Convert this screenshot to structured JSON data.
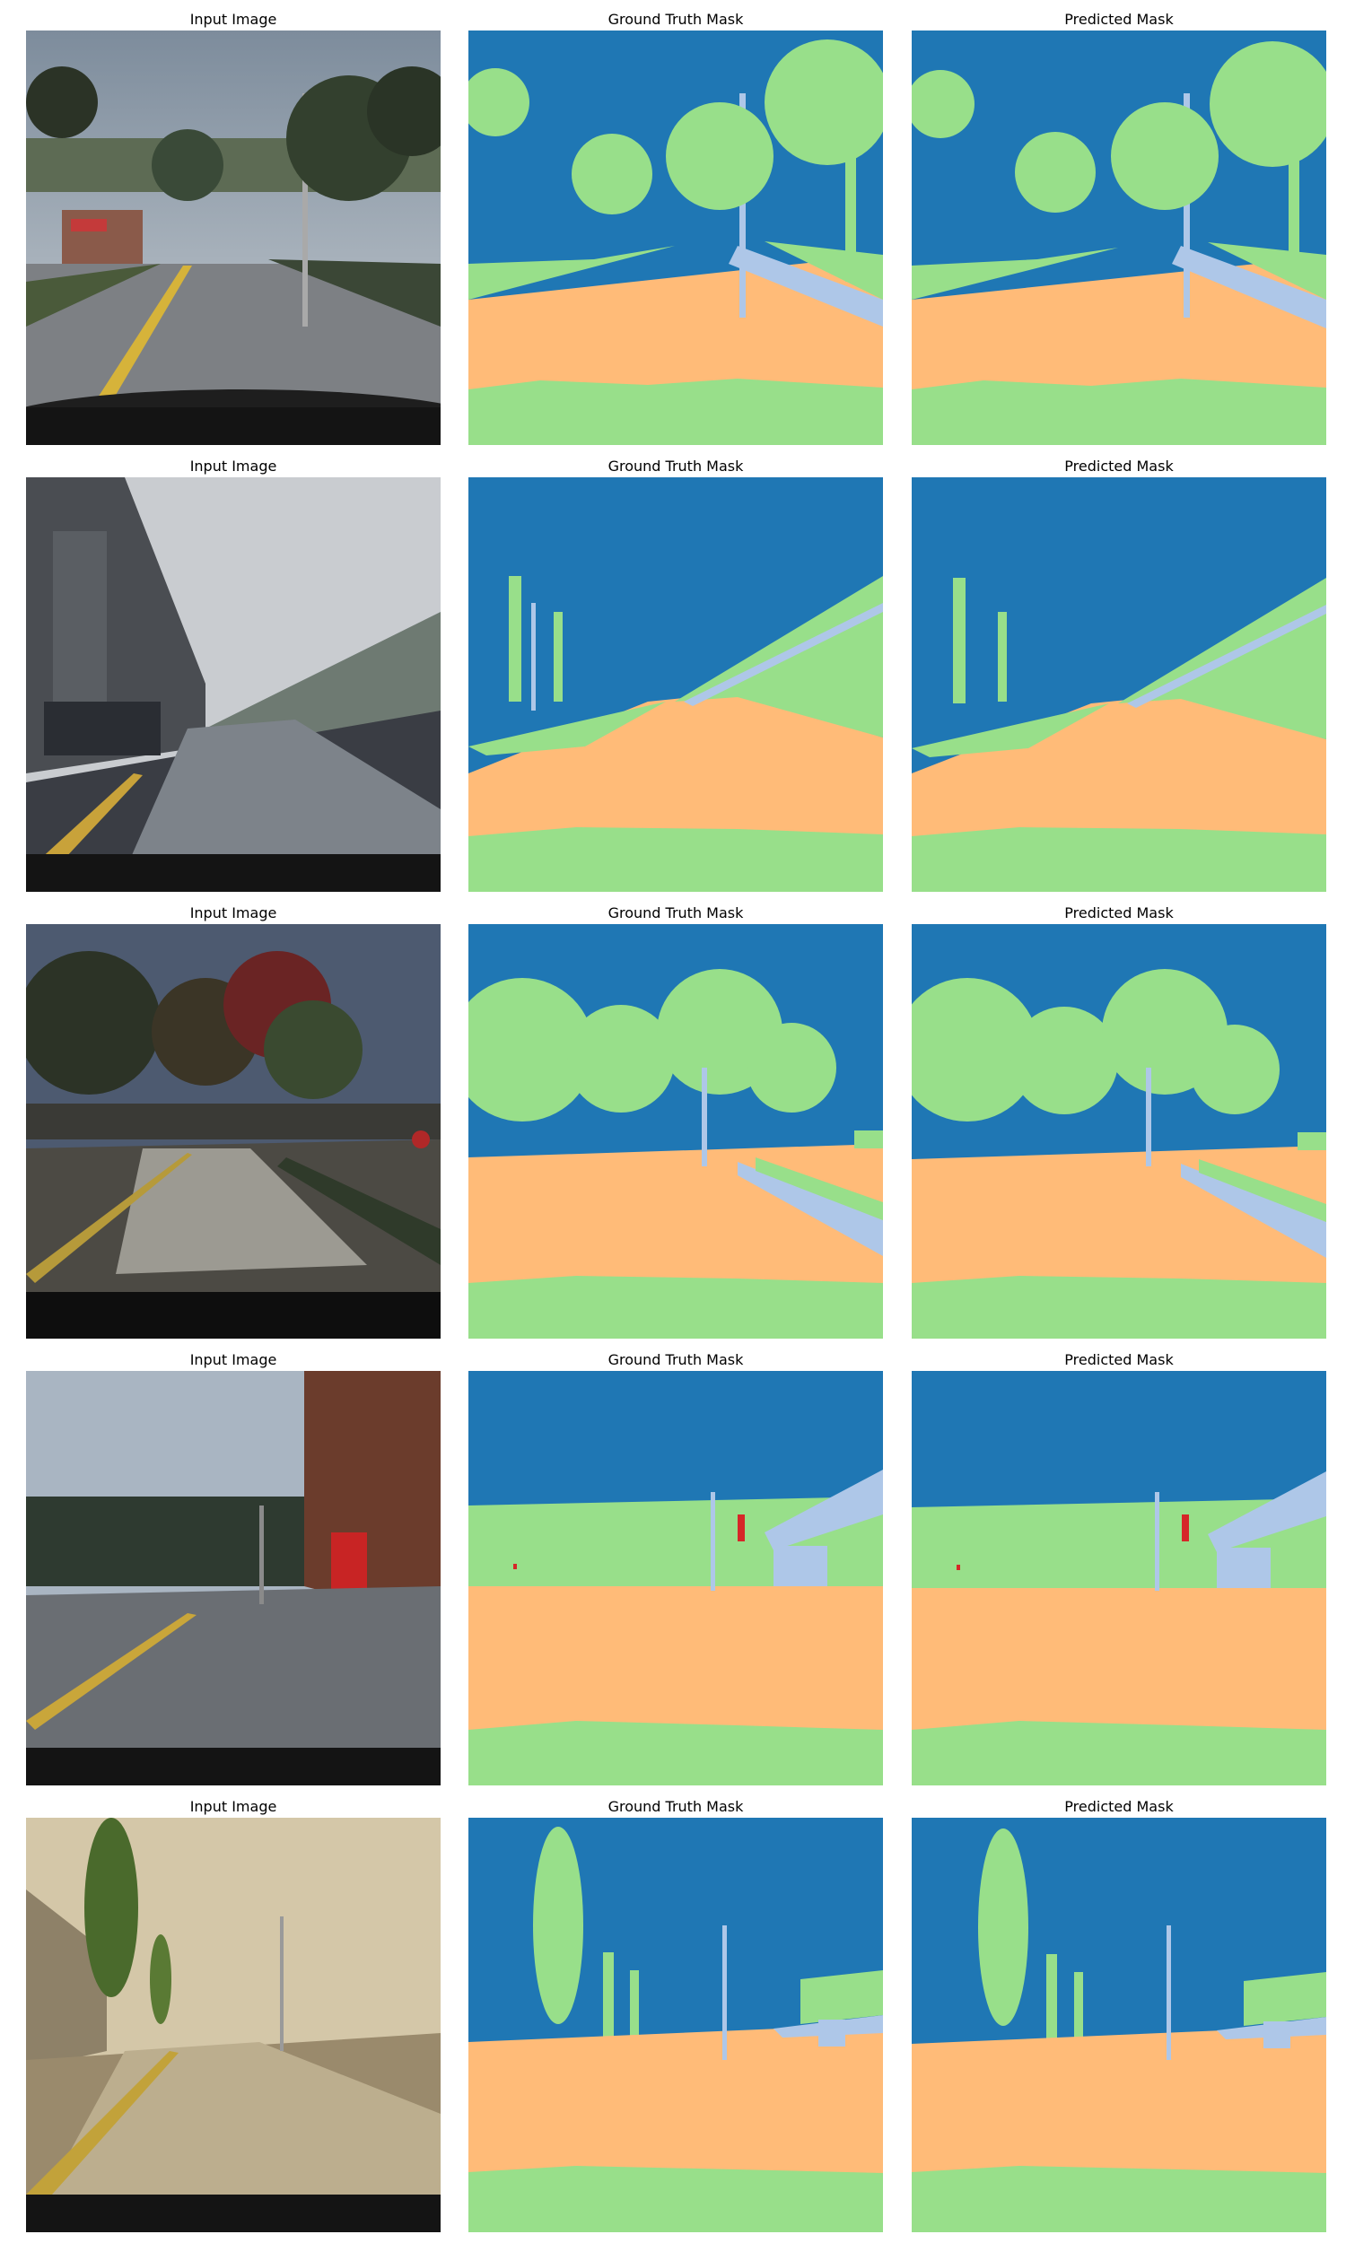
{
  "colors": {
    "sky": "#1f77b4",
    "vegetation": "#98df8a",
    "road": "#ffbb78",
    "structure": "#aec7e8",
    "traffic_light": "#d62728"
  },
  "rows": [
    {
      "input_title": "Input Image",
      "gt_title": "Ground Truth Mask",
      "pred_title": "Predicted Mask"
    },
    {
      "input_title": "Input Image",
      "gt_title": "Ground Truth Mask",
      "pred_title": "Predicted Mask"
    },
    {
      "input_title": "Input Image",
      "gt_title": "Ground Truth Mask",
      "pred_title": "Predicted Mask"
    },
    {
      "input_title": "Input Image",
      "gt_title": "Ground Truth Mask",
      "pred_title": "Predicted Mask"
    },
    {
      "input_title": "Input Image",
      "gt_title": "Ground Truth Mask",
      "pred_title": "Predicted Mask"
    }
  ]
}
